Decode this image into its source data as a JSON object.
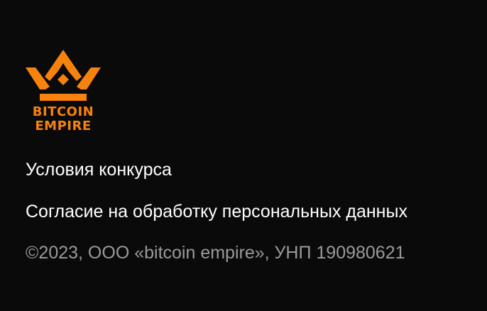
{
  "brand": {
    "name_line1": "BITCOIN",
    "name_line2": "EMPIRE",
    "logo_icon": "crown-icon",
    "accent_color": "#f7820e"
  },
  "links": {
    "terms_label": "Условия конкурса",
    "consent_label": "Согласие на обработку персональных данных"
  },
  "footer": {
    "copyright": "©2023, ООО «bitcoin empire», УНП 190980621",
    "copyright_color": "#9a9a9a"
  },
  "background_color": "#0a0a0a"
}
